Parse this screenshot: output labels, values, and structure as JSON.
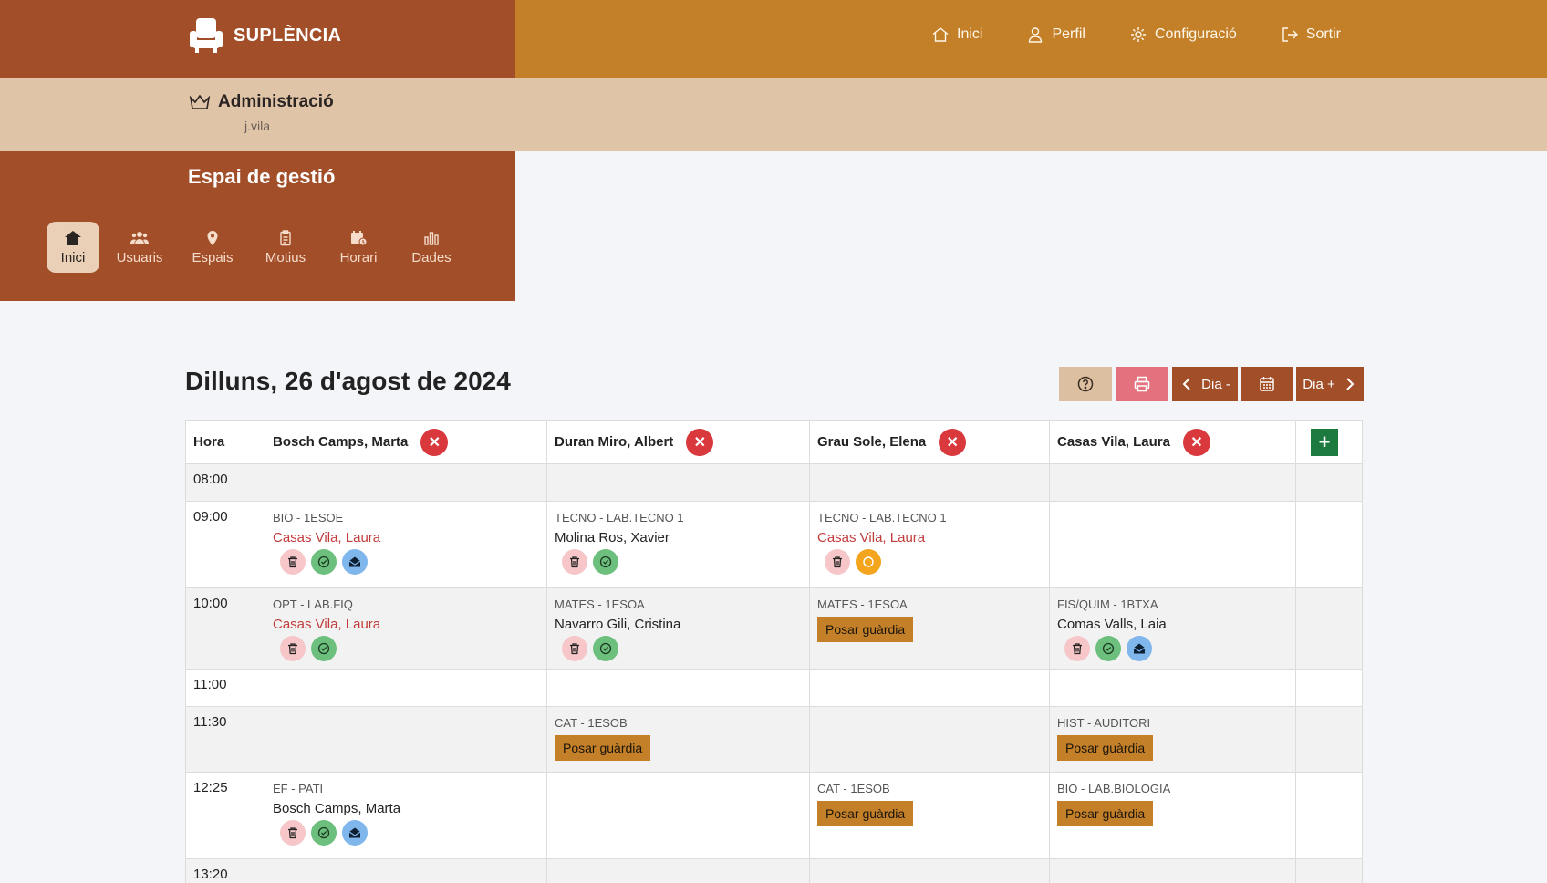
{
  "app": {
    "brand": "SUPLÈNCIA",
    "nav": [
      {
        "label": "Inici",
        "icon": "home-icon"
      },
      {
        "label": "Perfil",
        "icon": "user-icon"
      },
      {
        "label": "Configuració",
        "icon": "gear-icon"
      },
      {
        "label": "Sortir",
        "icon": "logout-icon"
      }
    ]
  },
  "admin": {
    "title": "Administració",
    "user": "j.vila"
  },
  "management": {
    "title": "Espai de gestió",
    "tabs": [
      {
        "label": "Inici",
        "icon": "home-icon",
        "active": true
      },
      {
        "label": "Usuaris",
        "icon": "users-icon"
      },
      {
        "label": "Espais",
        "icon": "map-pin-icon"
      },
      {
        "label": "Motius",
        "icon": "clipboard-icon"
      },
      {
        "label": "Horari",
        "icon": "calendar-clock-icon"
      },
      {
        "label": "Dades",
        "icon": "bar-chart-icon"
      }
    ]
  },
  "schedule": {
    "date": "Dilluns, 26 d'agost de 2024",
    "toolbar": {
      "prev_label": "Dia -",
      "next_label": "Dia +"
    },
    "hour_header": "Hora",
    "columns": [
      "Bosch Camps, Marta",
      "Duran Miro, Albert",
      "Grau Sole, Elena",
      "Casas Vila, Laura"
    ],
    "guard_label": "Posar guàrdia",
    "hours": [
      "08:00",
      "09:00",
      "10:00",
      "11:00",
      "11:30",
      "12:25",
      "13:20"
    ],
    "cells": {
      "r1c1": {
        "subject": "BIO - 1ESOE",
        "teacher": "Casas Vila, Laura"
      },
      "r1c2": {
        "subject": "TECNO - LAB.TECNO 1",
        "teacher": "Molina Ros, Xavier"
      },
      "r1c3": {
        "subject": "TECNO - LAB.TECNO 1",
        "teacher": "Casas Vila, Laura"
      },
      "r2c1": {
        "subject": "OPT - LAB.FIQ",
        "teacher": "Casas Vila, Laura"
      },
      "r2c2": {
        "subject": "MATES - 1ESOA",
        "teacher": "Navarro Gili, Cristina"
      },
      "r2c3": {
        "subject": "MATES - 1ESOA"
      },
      "r2c4": {
        "subject": "FIS/QUIM - 1BTXA",
        "teacher": "Comas Valls, Laia"
      },
      "r4c2": {
        "subject": "CAT - 1ESOB"
      },
      "r4c4": {
        "subject": "HIST - AUDITORI"
      },
      "r5c1": {
        "subject": "EF - PATI",
        "teacher": "Bosch Camps, Marta"
      },
      "r5c3": {
        "subject": "CAT - 1ESOB"
      },
      "r5c4": {
        "subject": "BIO - LAB.BIOLOGIA"
      }
    }
  },
  "colors": {
    "brand_dark": "#a24e29",
    "brand_gold": "#c38029",
    "admin_strip": "#e0c4a8",
    "danger": "#d9383c",
    "success": "#1d7a3f",
    "teacher_red": "#c23b3b"
  }
}
